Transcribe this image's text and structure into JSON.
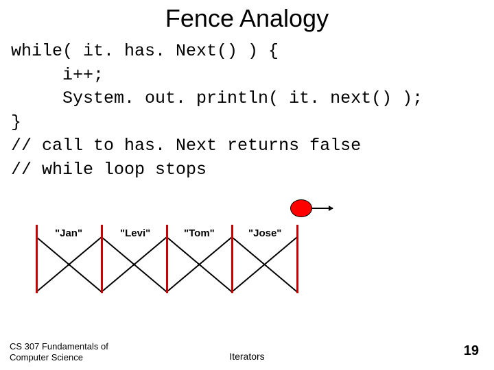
{
  "title": "Fence Analogy",
  "code": {
    "l1": "while( it. has. Next() ) {",
    "l2": "     i++;",
    "l3": "     System. out. println( it. next() );",
    "l4": "}",
    "l5": "// call to has. Next returns false",
    "l6": "// while loop stops"
  },
  "fence": {
    "labels": [
      "\"Jan\"",
      "\"Levi\"",
      "\"Tom\"",
      "\"Jose\""
    ]
  },
  "footer": {
    "left_line1": "CS 307 Fundamentals of",
    "left_line2": "Computer Science",
    "center": "Iterators",
    "pagenum": "19"
  }
}
